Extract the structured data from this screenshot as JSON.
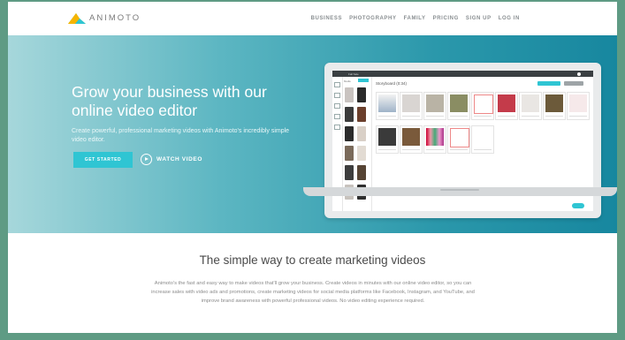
{
  "brand": {
    "name": "ANIMOTO",
    "colors": {
      "accent": "#2fc5d3",
      "frame": "#5f9b84"
    }
  },
  "nav": {
    "items": [
      "BUSINESS",
      "PHOTOGRAPHY",
      "FAMILY",
      "PRICING",
      "SIGN UP",
      "LOG IN"
    ]
  },
  "hero": {
    "title": "Grow your business with our online video editor",
    "subtitle": "Create powerful, professional marketing videos with Animoto's incredibly simple video editor.",
    "cta_label": "GET STARTED",
    "watch_label": "WATCH VIDEO",
    "icons": {
      "play": "play-circle-icon",
      "logo": "animoto-logo"
    }
  },
  "editor_preview": {
    "window_title": "Fall Sale",
    "storyboard_title": "Storyboard (0:34)",
    "panel_tab": "Media"
  },
  "section": {
    "title": "The simple way to create marketing videos",
    "body": "Animoto's the fast and easy way to make videos that'll grow your business. Create videos in minutes with our online video editor, so you can increase sales with video ads and promotions, create marketing videos for social media platforms like Facebook, Instagram, and YouTube, and improve brand awareness with powerful professional videos. No video editing experience required."
  }
}
